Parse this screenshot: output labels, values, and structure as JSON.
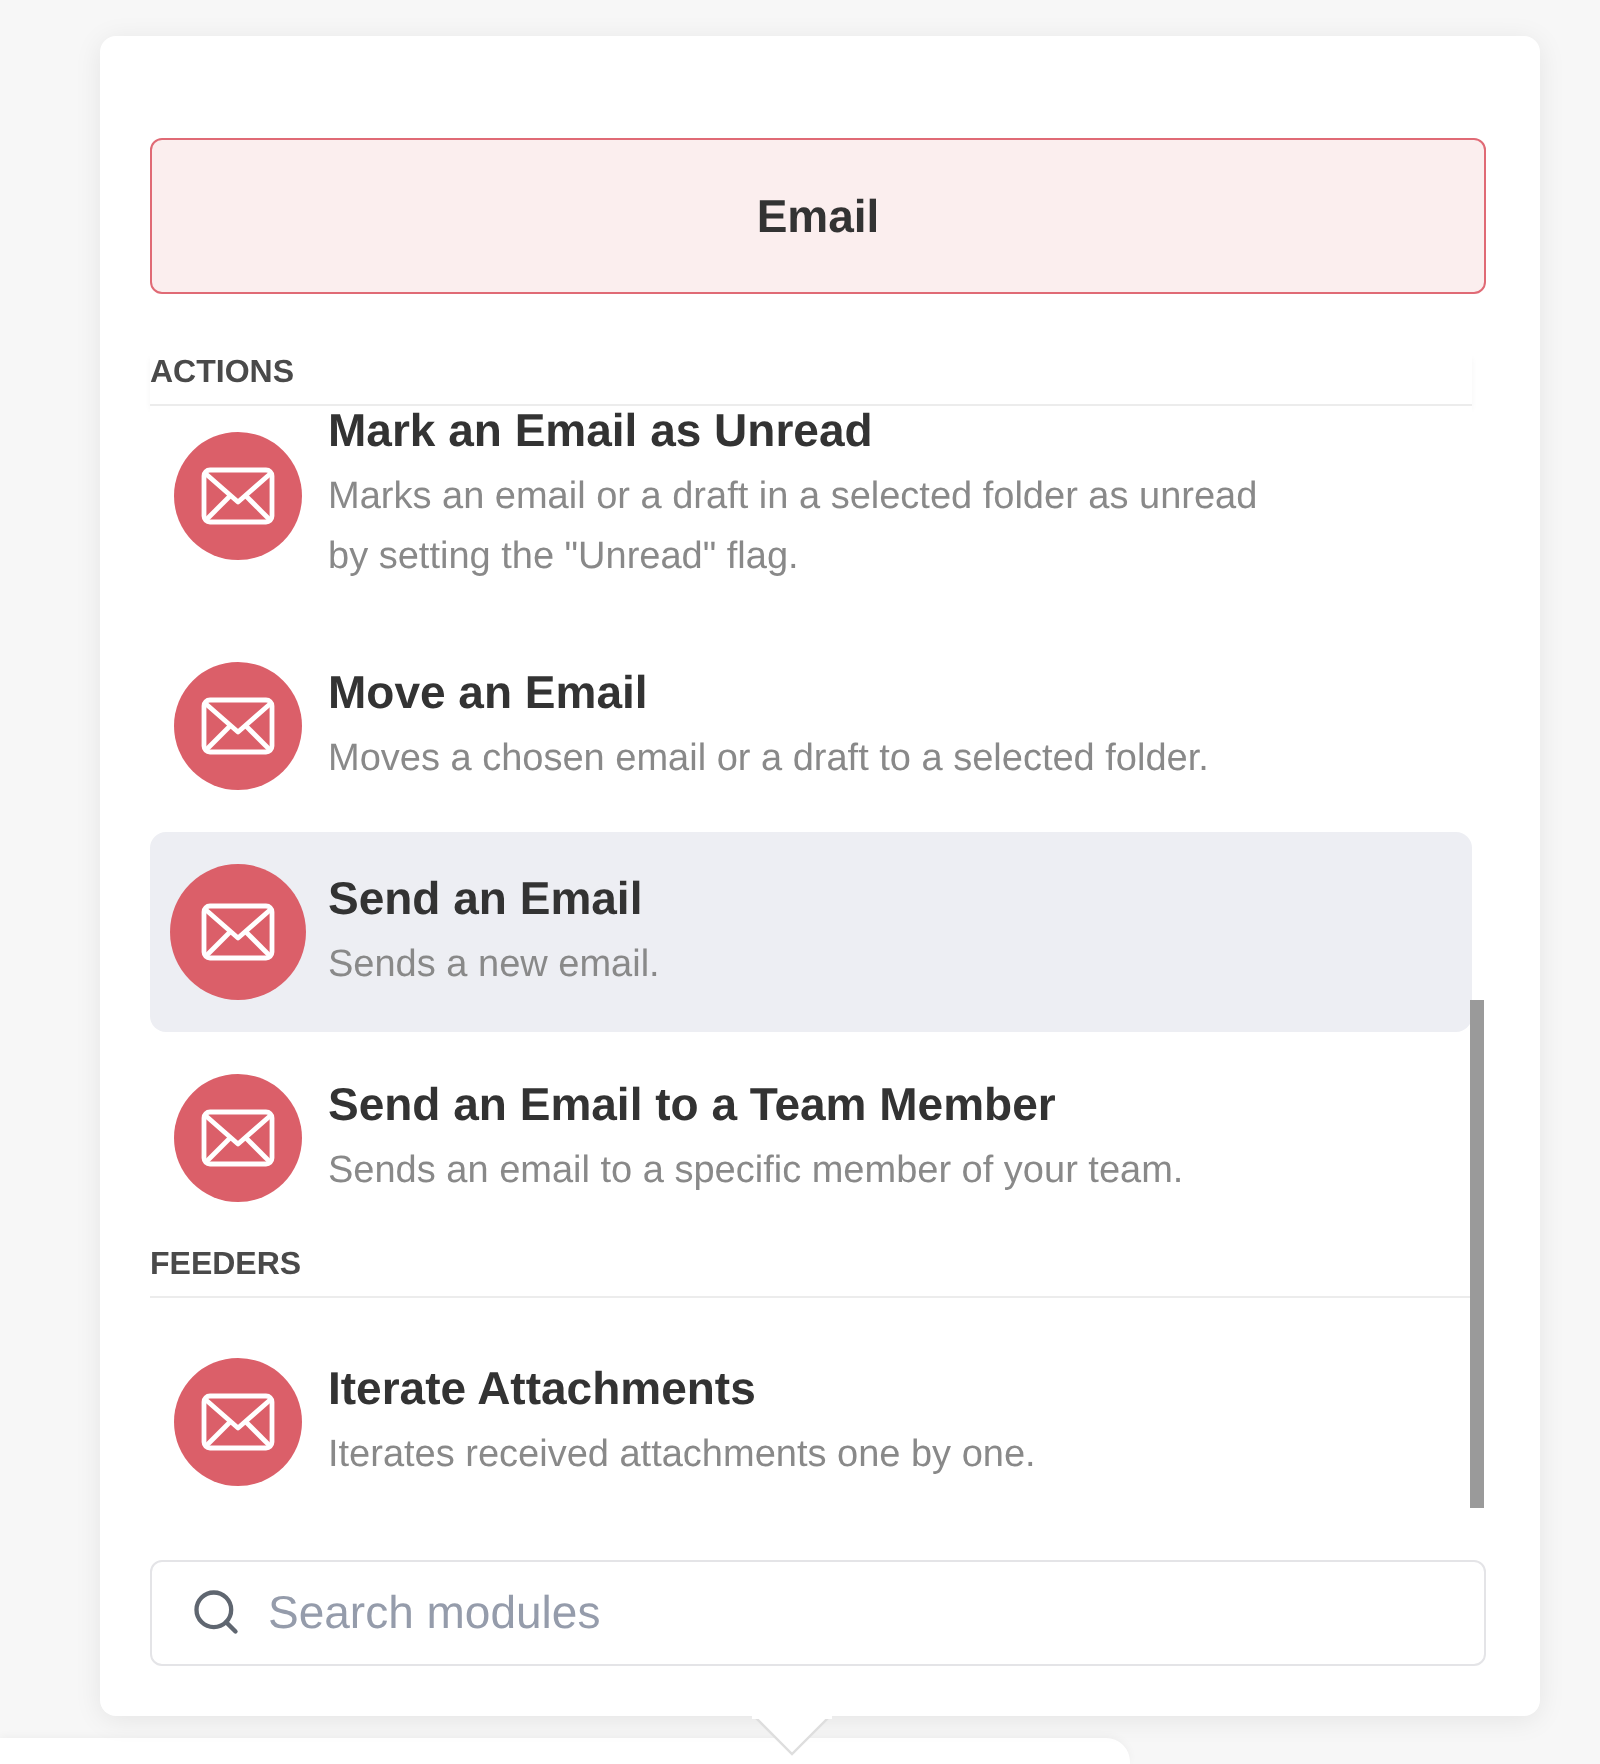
{
  "header": {
    "title": "Email"
  },
  "sections": [
    {
      "label": "ACTIONS",
      "items": [
        {
          "title": "Mark an Email as Unread",
          "description": "Marks an email or a draft in a selected folder as unread by setting the \"Unread\" flag.",
          "selected": false
        },
        {
          "title": "Move an Email",
          "description": "Moves a chosen email or a draft to a selected folder.",
          "selected": false
        },
        {
          "title": "Send an Email",
          "description": "Sends a new email.",
          "selected": true
        },
        {
          "title": "Send an Email to a Team Member",
          "description": "Sends an email to a specific member of your team.",
          "selected": false
        }
      ]
    },
    {
      "label": "FEEDERS",
      "items": [
        {
          "title": "Iterate Attachments",
          "description": "Iterates received attachments one by one.",
          "selected": false
        }
      ]
    }
  ],
  "search": {
    "placeholder": "Search modules"
  }
}
